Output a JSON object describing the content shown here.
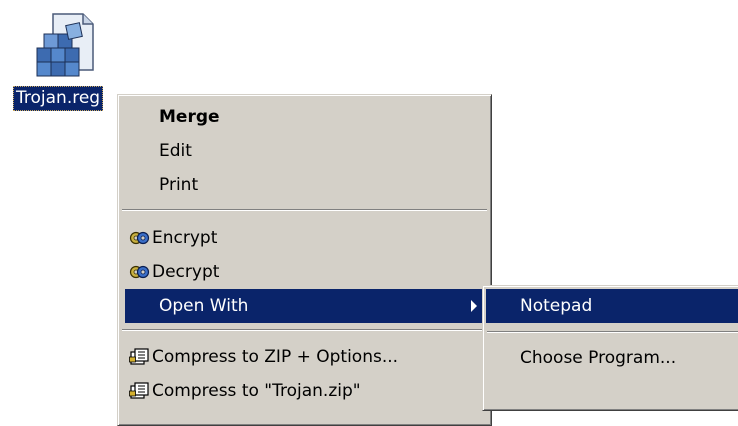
{
  "desktop": {
    "file": {
      "name": "Trojan.reg",
      "icon": "registry-file-icon"
    }
  },
  "context_menu": {
    "items": [
      {
        "label": "Merge",
        "bold": true
      },
      {
        "label": "Edit"
      },
      {
        "label": "Print"
      },
      {
        "label": "Encrypt",
        "icon": "encryption-keys-icon"
      },
      {
        "label": "Decrypt",
        "icon": "encryption-keys-icon"
      },
      {
        "label": "Open With",
        "highlighted": true,
        "has_submenu": true
      },
      {
        "label": "Compress to ZIP + Options...",
        "icon": "zip-archive-icon"
      },
      {
        "label": "Compress to \"Trojan.zip\"",
        "icon": "zip-archive-icon"
      }
    ]
  },
  "open_with_submenu": {
    "items": [
      {
        "label": "Notepad",
        "highlighted": true
      },
      {
        "label": "Choose Program..."
      }
    ]
  },
  "colors": {
    "selection": "#0a246a",
    "menu_face": "#d4d0c8",
    "selection_text": "#ffffff"
  }
}
